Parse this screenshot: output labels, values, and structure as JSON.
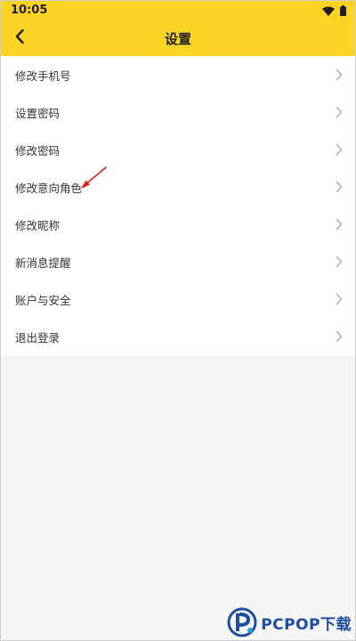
{
  "status_bar": {
    "time": "10:05",
    "wifi_icon": "wifi-icon",
    "battery_icon": "battery-icon"
  },
  "header": {
    "title": "设置",
    "back_icon": "chevron-left-icon",
    "background_color": "#fbd426"
  },
  "settings": {
    "items": [
      {
        "label": "修改手机号"
      },
      {
        "label": "设置密码"
      },
      {
        "label": "修改密码"
      },
      {
        "label": "修改意向角色"
      },
      {
        "label": "修改昵称"
      },
      {
        "label": "新消息提醒"
      },
      {
        "label": "账户与安全"
      },
      {
        "label": "退出登录"
      }
    ],
    "chevron_icon": "chevron-right-icon"
  },
  "annotation": {
    "arrow_color": "#e0201c",
    "target_item": "修改意向角色"
  },
  "watermark": {
    "text": "PCPOP下载",
    "color": "#1f4da3"
  }
}
